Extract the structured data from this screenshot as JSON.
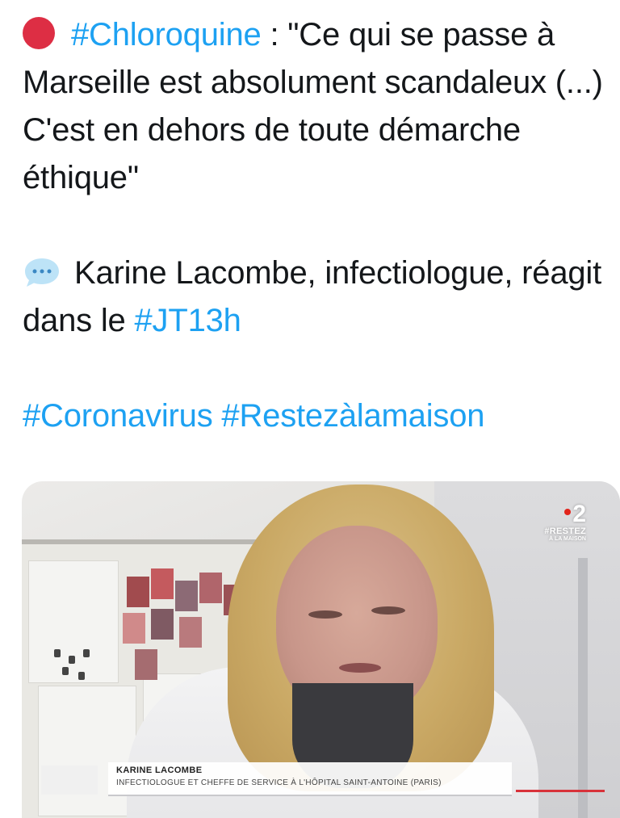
{
  "tweet": {
    "line1_rest": " : \"Ce qui se passe à Marseille est absolument scandaleux (...) C'est en dehors de toute démarche éthique\"",
    "hashtag_chloroquine": "#Chloroquine",
    "line2_text": "Karine Lacombe, infectiologue, réagit dans le ",
    "hashtag_jt": "#JT13h",
    "hashtag_coronavirus": "#Coronavirus",
    "hashtag_restez": "#Restezàlamaison",
    "emoji_1": "red-circle-icon",
    "emoji_2": "speech-bubble-icon"
  },
  "media": {
    "channel_logo": "2",
    "channel_tag": "#RESTEZ",
    "channel_tag_small": "À LA MAISON",
    "lower_third_name": "KARINE LACOMBE",
    "lower_third_role": "INFECTIOLOGUE ET CHEFFE DE SERVICE À L'HÔPITAL SAINT-ANTOINE (PARIS)"
  },
  "colors": {
    "hashtag": "#1da1f2",
    "text": "#14171a",
    "red_circle": "#dd2e44",
    "speech_bubble": "#bde3f7"
  }
}
